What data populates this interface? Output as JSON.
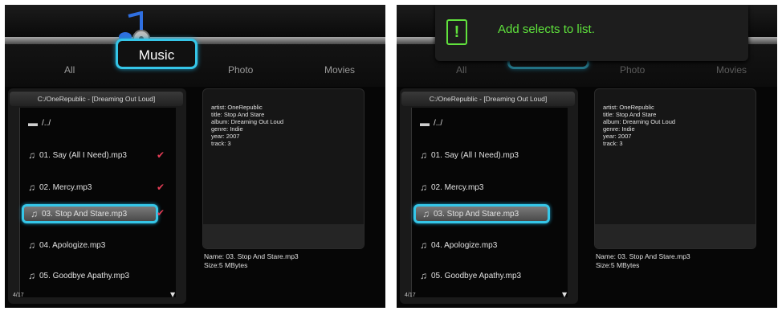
{
  "tabs": [
    "All",
    "Music",
    "Photo",
    "Movies"
  ],
  "popup": {
    "icon": "!",
    "text": "Add selects to list."
  },
  "path": "C:/OneRepublic - [Dreaming Out Loud]",
  "list": {
    "parent": "/../",
    "items": [
      {
        "label": "01. Say (All I Need).mp3",
        "checked": true
      },
      {
        "label": "02. Mercy.mp3",
        "checked": true
      },
      {
        "label": "03. Stop And Stare.mp3",
        "checked": true
      },
      {
        "label": "04. Apologize.mp3",
        "checked": false
      },
      {
        "label": "05. Goodbye Apathy.mp3",
        "checked": false
      }
    ],
    "pager": "4/17"
  },
  "meta": {
    "artist": "artist: OneRepublic",
    "title": "title: Stop And Stare",
    "album": "album: Dreaming Out Loud",
    "genre": "genre: Indie",
    "year": "year: 2007",
    "track": "track: 3"
  },
  "file": {
    "name": "Name: 03. Stop And Stare.mp3",
    "size": "Size:5 MBytes"
  },
  "colors": {
    "highlight": "#35c6e8",
    "check": "#e53d56",
    "popup_text": "#5fe33c"
  }
}
